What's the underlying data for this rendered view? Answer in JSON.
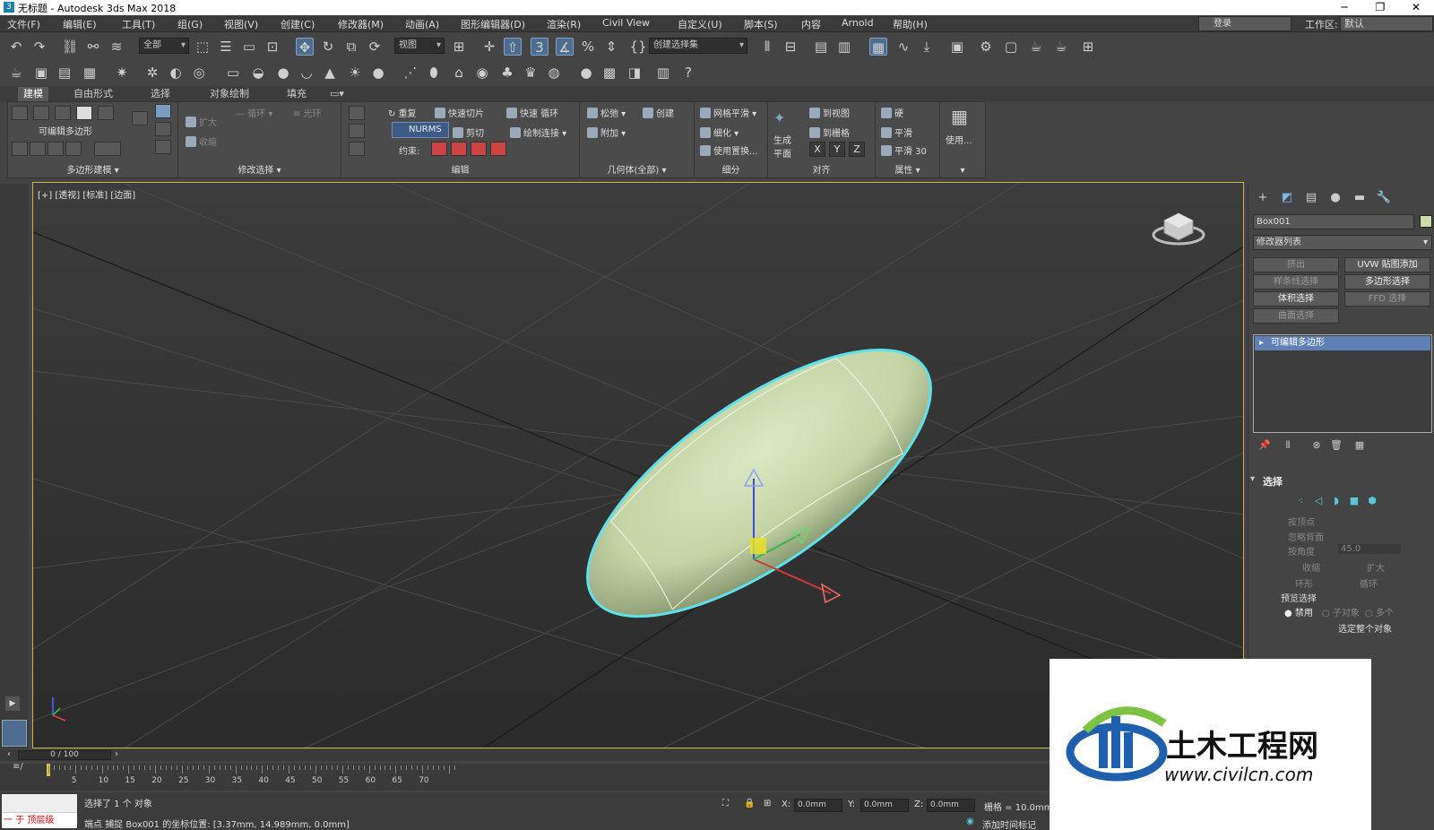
{
  "window": {
    "title": "无标题 - Autodesk 3ds Max 2018",
    "app_icon": "3",
    "controls": [
      "─",
      "❐",
      "✕"
    ]
  },
  "menu": {
    "items": [
      "文件(F)",
      "编辑(E)",
      "工具(T)",
      "组(G)",
      "视图(V)",
      "创建(C)",
      "修改器(M)",
      "动画(A)",
      "图形编辑器(D)",
      "渲染(R)",
      "Civil View",
      "自定义(U)",
      "脚本(S)",
      "内容",
      "Arnold",
      "帮助(H)"
    ],
    "login": "登录",
    "workspace_label": "工作区:",
    "workspace_value": "默认"
  },
  "toolbar": {
    "selection_filter": "全部",
    "ref_coord": "视图",
    "named_selection": "创建选择集"
  },
  "ribbon": {
    "tabs": [
      "建模",
      "自由形式",
      "选择",
      "对象绘制",
      "填充"
    ],
    "active_tab": "建模",
    "groups": {
      "poly_modeling": "多边形建模",
      "poly_modeling_label": "可编辑多边形",
      "modify_sel": "修改选择",
      "edit": "编辑",
      "geometry": "几何体(全部)",
      "subdivision": "细分",
      "align": "对齐",
      "properties": "属性"
    },
    "modsel": {
      "grow": "扩大",
      "shrink": "收缩",
      "loop": "循环",
      "ring": "光环"
    },
    "edit_buttons": {
      "repeat": "重复",
      "quickslice": "快速切片",
      "quickloop": "快速 循环",
      "nurms": "NURMS",
      "cut": "剪切",
      "paint_connect": "绘制连接",
      "constraint_label": "约束:"
    },
    "geometry_buttons": {
      "relax": "松弛",
      "create": "创建",
      "attach": "附加"
    },
    "subdiv_buttons": {
      "meshsmooth": "网格平滑",
      "tessellate": "细化",
      "use_displace": "使用置换..."
    },
    "align_buttons": {
      "make_planar": "生成平面",
      "to_view": "到视图",
      "to_grid": "到栅格",
      "x": "X",
      "y": "Y",
      "z": "Z"
    },
    "prop_buttons": {
      "hard": "硬",
      "smooth": "平滑",
      "smooth30": "平滑 30"
    },
    "use_label": "使用..."
  },
  "viewport": {
    "label": "[+] [透视] [标准] [边面]"
  },
  "command_panel": {
    "object_name": "Box001",
    "modifier_list": "修改器列表",
    "modifier_buttons": [
      {
        "label": "挤出",
        "on": false
      },
      {
        "label": "UVW 贴图添加",
        "on": true
      },
      {
        "label": "样条线选择",
        "on": false
      },
      {
        "label": "多边形选择",
        "on": true
      },
      {
        "label": "体积选择",
        "on": true
      },
      {
        "label": "FFD 选择",
        "on": false
      },
      {
        "label": "曲面选择",
        "on": false
      }
    ],
    "stack_item": "可编辑多边形",
    "selection_rollout": "选择",
    "by_vertex": "按顶点",
    "ignore_backfacing": "忽略背面",
    "by_angle": "按角度",
    "angle_value": "45.0",
    "shrink": "收缩",
    "grow": "扩大",
    "ring": "环形",
    "loop": "循环",
    "preview_selection": "预览选择",
    "preview_off": "禁用",
    "preview_subobj": "子对象",
    "preview_multi": "多个",
    "whole_object": "选定整个对象"
  },
  "timeline": {
    "slider": "0 / 100",
    "ticks": [
      5,
      10,
      15,
      20,
      25,
      30,
      35,
      40,
      45,
      50,
      55,
      60,
      65,
      70
    ],
    "end_tick": 100
  },
  "status": {
    "maxscript_label": "一 于 顶层级",
    "selected": "选择了 1 个 对象",
    "snap_info": "端点 捕捉 Box001 的坐标位置: [3.37mm, 14.989mm, 0.0mm]",
    "x": "0.0mm",
    "y": "0.0mm",
    "z": "0.0mm",
    "grid": "栅格 = 10.0mm",
    "add_time_tag": "添加时间标记"
  },
  "watermark": {
    "title": "土木工程网",
    "url": "www.civilcn.com"
  },
  "colors": {
    "accent_blue": "#5f80b5",
    "viewport_border": "#c9b54a",
    "selection_cyan": "#55d9e6",
    "object_fill": "#cfdcb4"
  }
}
